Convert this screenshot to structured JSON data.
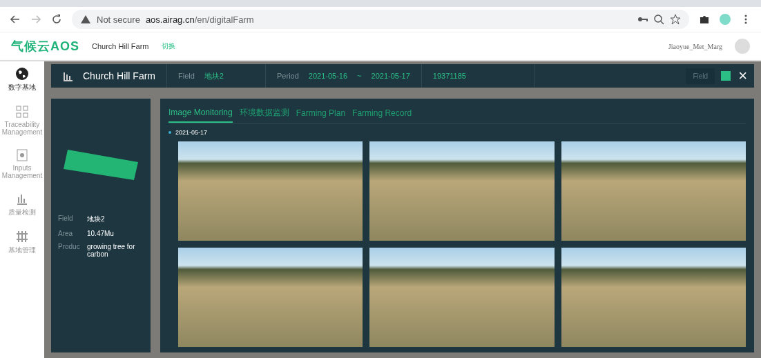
{
  "browser": {
    "security": "Not secure",
    "url_host": "aos.airag.cn",
    "url_path": "/en/digitalFarm"
  },
  "app_header": {
    "logo": "气候云AOS",
    "farm": "Church Hill Farm",
    "switch": "切换",
    "user": "Jiaoyue_Met_Marg"
  },
  "sidebar": {
    "items": [
      {
        "label": "数字基地",
        "selected": true
      },
      {
        "label": "Traceability Management",
        "selected": false
      },
      {
        "label": "Inputs Management",
        "selected": false
      },
      {
        "label": "质量检测",
        "selected": false
      },
      {
        "label": "基地管理",
        "selected": false
      }
    ]
  },
  "panel_header": {
    "title": "Church Hill Farm",
    "field_label": "Field",
    "field_value": "地块2",
    "period_label": "Period",
    "period_start": "2021-05-16",
    "period_sep": "~",
    "period_end": "2021-05-17",
    "code": "19371185",
    "field_button": "Field",
    "close": "×"
  },
  "field_info": {
    "rows": [
      {
        "label": "Field",
        "value": "地块2"
      },
      {
        "label": "Area",
        "value": "10.47Mu"
      },
      {
        "label": "Produc",
        "value": "growing tree for carbon"
      }
    ]
  },
  "tabs": [
    {
      "label": "Image Monitoring",
      "selected": true
    },
    {
      "label": "环境数据监测",
      "selected": false
    },
    {
      "label": "Farming Plan",
      "selected": false
    },
    {
      "label": "Farming Record",
      "selected": false
    }
  ],
  "gallery": {
    "date": "2021-05-17"
  }
}
